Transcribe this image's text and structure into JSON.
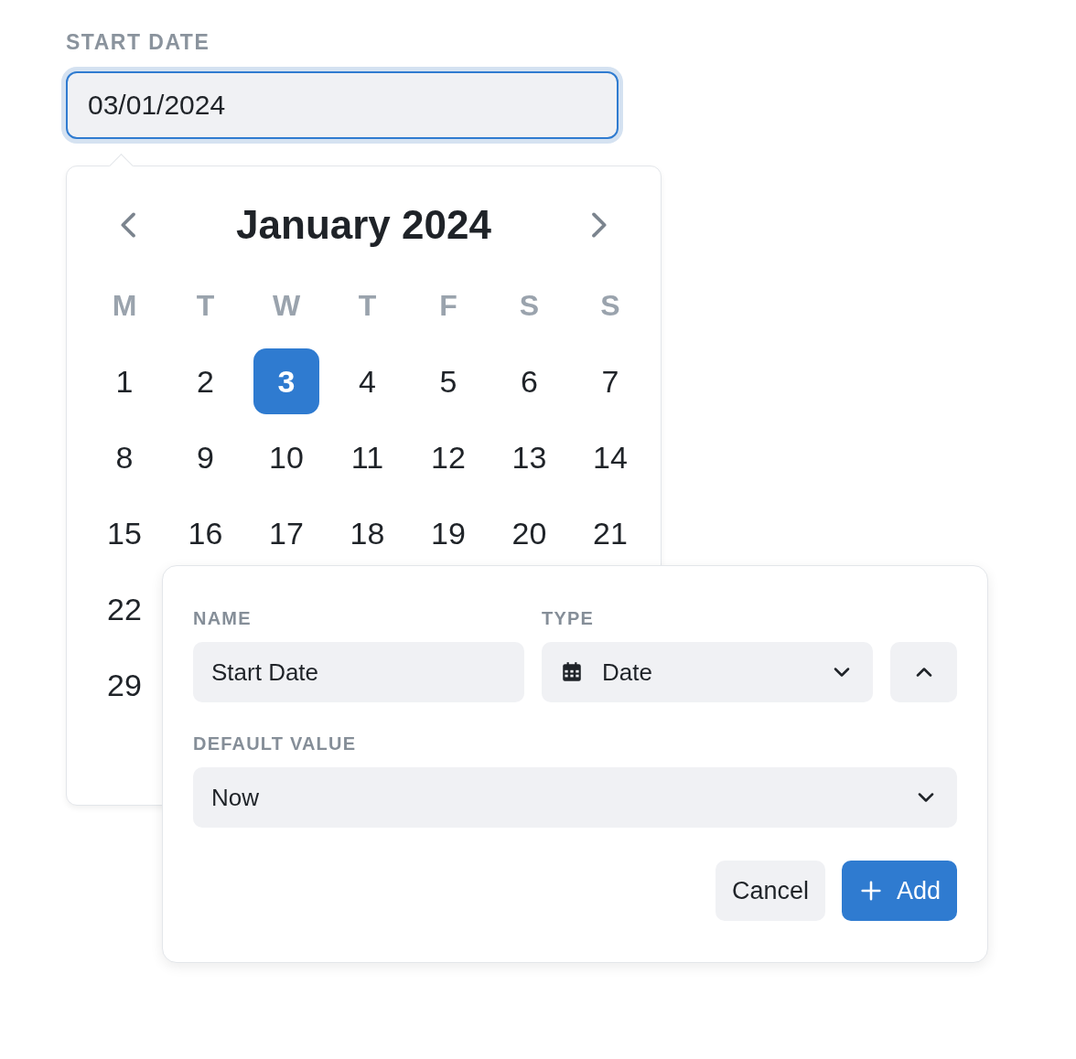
{
  "start_date": {
    "label": "START DATE",
    "value": "03/01/2024"
  },
  "calendar": {
    "title": "January 2024",
    "weekdays": [
      "M",
      "T",
      "W",
      "T",
      "F",
      "S",
      "S"
    ],
    "weeks": [
      [
        {
          "label": "1",
          "selected": false
        },
        {
          "label": "2",
          "selected": false
        },
        {
          "label": "3",
          "selected": true
        },
        {
          "label": "4",
          "selected": false
        },
        {
          "label": "5",
          "selected": false
        },
        {
          "label": "6",
          "selected": false
        },
        {
          "label": "7",
          "selected": false
        }
      ],
      [
        {
          "label": "8",
          "selected": false
        },
        {
          "label": "9",
          "selected": false
        },
        {
          "label": "10",
          "selected": false
        },
        {
          "label": "11",
          "selected": false
        },
        {
          "label": "12",
          "selected": false
        },
        {
          "label": "13",
          "selected": false
        },
        {
          "label": "14",
          "selected": false
        }
      ],
      [
        {
          "label": "15",
          "selected": false
        },
        {
          "label": "16",
          "selected": false
        },
        {
          "label": "17",
          "selected": false
        },
        {
          "label": "18",
          "selected": false
        },
        {
          "label": "19",
          "selected": false
        },
        {
          "label": "20",
          "selected": false
        },
        {
          "label": "21",
          "selected": false
        }
      ],
      [
        {
          "label": "22",
          "selected": false
        }
      ],
      [
        {
          "label": "29",
          "selected": false
        }
      ]
    ]
  },
  "dialog": {
    "name": {
      "label": "NAME",
      "value": "Start Date"
    },
    "type": {
      "label": "TYPE",
      "value": "Date"
    },
    "default_value": {
      "label": "DEFAULT VALUE",
      "value": "Now"
    },
    "buttons": [
      {
        "label": "Cancel",
        "kind": "secondary"
      },
      {
        "label": "Add",
        "kind": "primary"
      }
    ]
  }
}
